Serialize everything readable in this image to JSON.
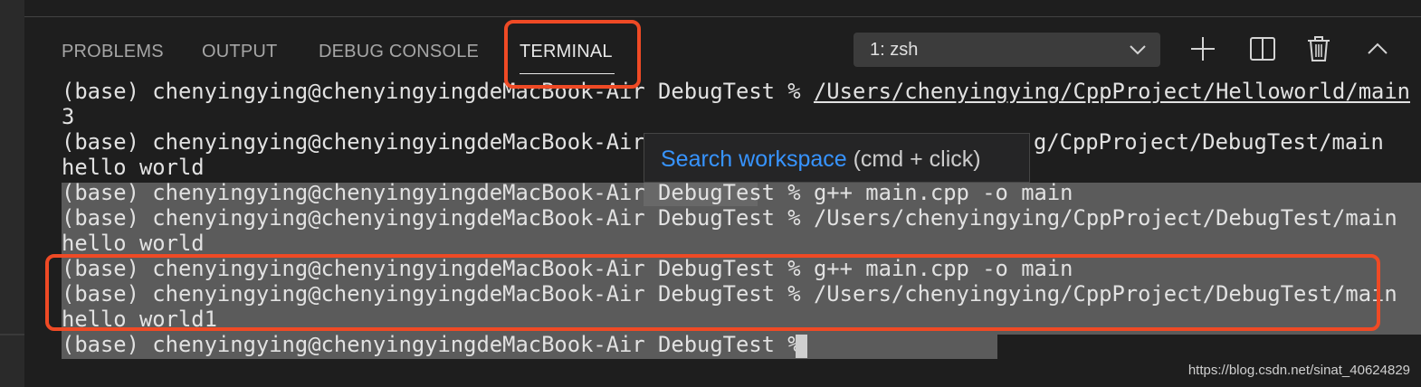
{
  "panel": {
    "tabs": [
      {
        "label": "PROBLEMS",
        "active": false
      },
      {
        "label": "OUTPUT",
        "active": false
      },
      {
        "label": "DEBUG CONSOLE",
        "active": false
      },
      {
        "label": "TERMINAL",
        "active": true
      }
    ],
    "terminal_select": {
      "value": "1: zsh",
      "icon": "chevron-down-icon"
    },
    "actions": [
      {
        "icon": "plus-icon"
      },
      {
        "icon": "split-terminal-icon"
      },
      {
        "icon": "trash-icon"
      },
      {
        "icon": "chevron-up-icon"
      }
    ]
  },
  "terminal": {
    "lines": [
      {
        "prompt": "(base) chenyingying@chenyingyingdeMacBook-Air DebugTest % ",
        "cmd": "/Users/chenyingying/CppProject/Helloworld/main"
      },
      {
        "text": "3"
      },
      {
        "prompt": "(base) chenyingying@chenyingyingdeMacBook-Air ",
        "cmd": "g/CppProject/DebugTest/main"
      },
      {
        "text": "hello world"
      },
      {
        "text": "(base) chenyingying@chenyingyingdeMacBook-Air DebugTest % g++ main.cpp -o main"
      },
      {
        "text": "(base) chenyingying@chenyingyingdeMacBook-Air DebugTest % /Users/chenyingying/CppProject/DebugTest/main"
      },
      {
        "text": "hello world"
      },
      {
        "text": "(base) chenyingying@chenyingyingdeMacBook-Air DebugTest % g++ main.cpp -o main"
      },
      {
        "text": "(base) chenyingying@chenyingyingdeMacBook-Air DebugTest % /Users/chenyingying/CppProject/DebugTest/main"
      },
      {
        "text": "hello world1"
      },
      {
        "text": "(base) chenyingying@chenyingyingdeMacBook-Air DebugTest % "
      }
    ]
  },
  "tooltip": {
    "link_text": "Search workspace",
    "hint_text": " (cmd + click)"
  },
  "watermark": "https://blog.csdn.net/sinat_40624829",
  "colors": {
    "accent": "#3794ff",
    "highlight_box": "#ef4a25"
  }
}
